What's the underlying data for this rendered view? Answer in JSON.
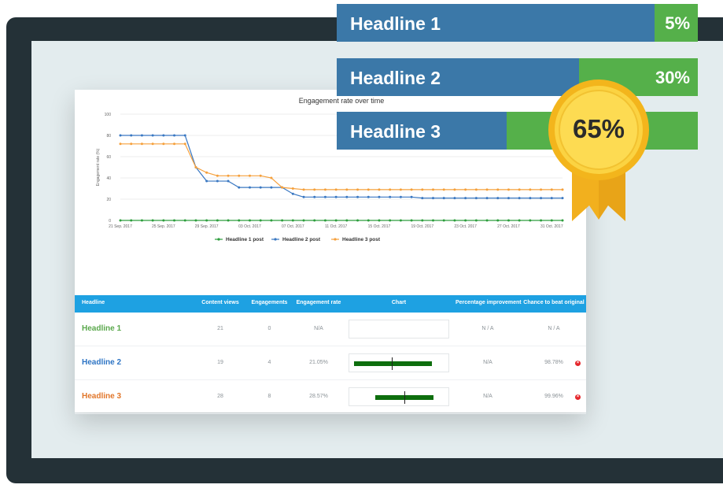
{
  "banners": [
    {
      "label": "Headline 1",
      "percent": "5%",
      "green_fraction": 0.12
    },
    {
      "label": "Headline 2",
      "percent": "30%",
      "green_fraction": 0.33
    },
    {
      "label": "Headline 3",
      "percent": "",
      "green_fraction": 0.53
    }
  ],
  "medal": {
    "text": "65%"
  },
  "chart_data": {
    "type": "line",
    "title": "Engagement rate over time",
    "ylabel": "Engagement rate (%)",
    "xlabel": "",
    "ylim": [
      0,
      100
    ],
    "yticks": [
      0,
      20,
      40,
      60,
      80,
      100
    ],
    "x_tick_labels": [
      "21 Sep. 2017",
      "25 Sep. 2017",
      "29 Sep. 2017",
      "03 Oct. 2017",
      "07 Oct. 2017",
      "11 Oct. 2017",
      "15 Oct. 2017",
      "19 Oct. 2017",
      "23 Oct. 2017",
      "27 Oct. 2017",
      "31 Oct. 2017"
    ],
    "x_days": [
      0,
      1,
      2,
      3,
      4,
      5,
      6,
      7,
      8,
      9,
      10,
      11,
      12,
      13,
      14,
      15,
      16,
      17,
      18,
      19,
      20,
      21,
      22,
      23,
      24,
      25,
      26,
      27,
      28,
      29,
      30,
      31,
      32,
      33,
      34,
      35,
      36,
      37,
      38,
      39,
      40,
      41
    ],
    "legend_position": "bottom",
    "grid": true,
    "series": [
      {
        "name": "Headline 1 post",
        "color": "#2e9e3e",
        "values": [
          0,
          0,
          0,
          0,
          0,
          0,
          0,
          0,
          0,
          0,
          0,
          0,
          0,
          0,
          0,
          0,
          0,
          0,
          0,
          0,
          0,
          0,
          0,
          0,
          0,
          0,
          0,
          0,
          0,
          0,
          0,
          0,
          0,
          0,
          0,
          0,
          0,
          0,
          0,
          0,
          0,
          0
        ]
      },
      {
        "name": "Headline 2 post",
        "color": "#3a78c2",
        "values": [
          80,
          80,
          80,
          80,
          80,
          80,
          80,
          50,
          37,
          37,
          37,
          31,
          31,
          31,
          31,
          31,
          25,
          22,
          22,
          22,
          22,
          22,
          22,
          22,
          22,
          22,
          22,
          22,
          21,
          21,
          21,
          21,
          21,
          21,
          21,
          21,
          21,
          21,
          21,
          21,
          21,
          21
        ]
      },
      {
        "name": "Headline 3 post",
        "color": "#f5a03c",
        "values": [
          72,
          72,
          72,
          72,
          72,
          72,
          72,
          50,
          45,
          42,
          42,
          42,
          42,
          42,
          40,
          31,
          30,
          29,
          29,
          29,
          29,
          29,
          29,
          29,
          29,
          29,
          29,
          29,
          29,
          29,
          29,
          29,
          29,
          29,
          29,
          29,
          29,
          29,
          29,
          29,
          29,
          29
        ]
      }
    ]
  },
  "table": {
    "headers": [
      "Headline",
      "Content views",
      "Engagements",
      "Engagement rate",
      "Chart",
      "Percentage improvement",
      "Chance to beat original"
    ],
    "rows": [
      {
        "name": "Headline 1",
        "color": "#5aa84c",
        "views": "21",
        "engagements": "0",
        "rate": "N/A",
        "improvement": "N / A",
        "chance": "N / A",
        "bar": null,
        "removable": false
      },
      {
        "name": "Headline 2",
        "color": "#2d74c4",
        "views": "19",
        "engagements": "4",
        "rate": "21.05%",
        "improvement": "N/A",
        "chance": "98.78%",
        "bar": {
          "low": 0.05,
          "high": 0.82,
          "mid": 0.42
        },
        "removable": true
      },
      {
        "name": "Headline 3",
        "color": "#e1762a",
        "views": "28",
        "engagements": "8",
        "rate": "28.57%",
        "improvement": "N/A",
        "chance": "99.96%",
        "bar": {
          "low": 0.26,
          "high": 0.84,
          "mid": 0.55
        },
        "removable": true
      }
    ]
  }
}
